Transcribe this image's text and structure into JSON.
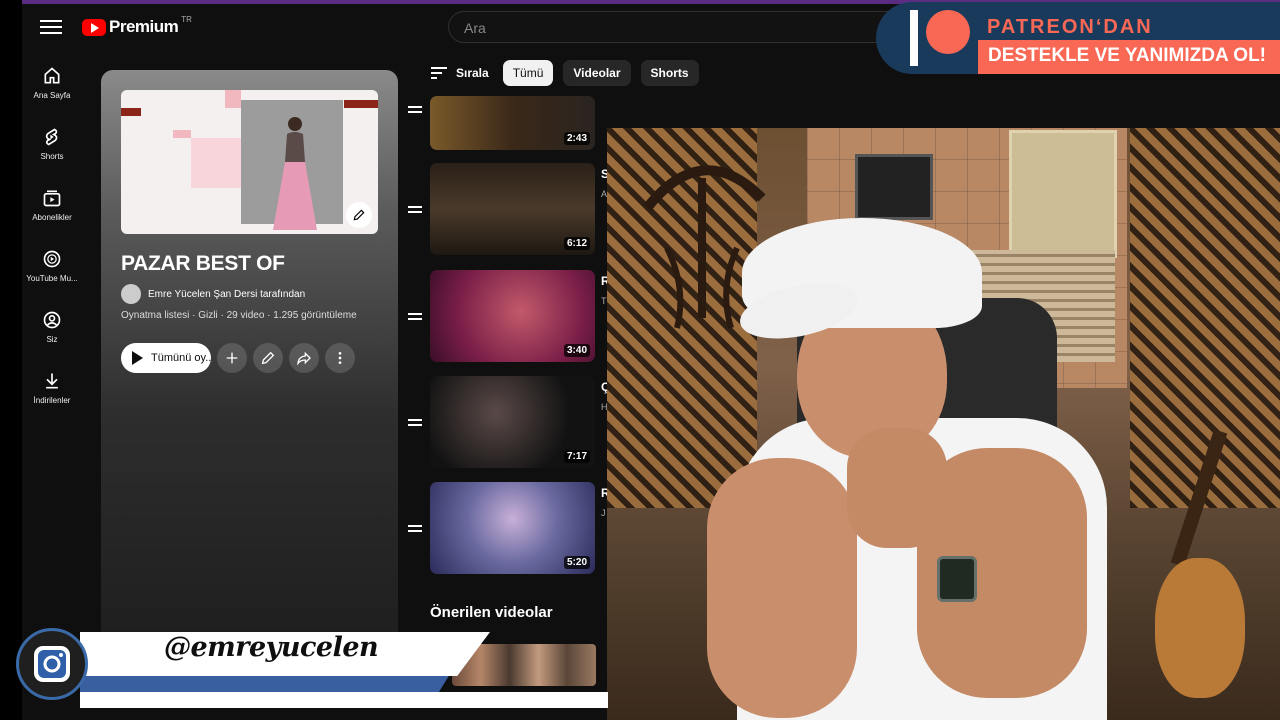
{
  "header": {
    "logo_text": "Premium",
    "logo_superscript": "TR",
    "search_placeholder": "Ara"
  },
  "sidebar": {
    "items": [
      {
        "label": "Ana Sayfa",
        "icon": "home-icon"
      },
      {
        "label": "Shorts",
        "icon": "shorts-icon"
      },
      {
        "label": "Abonelikler",
        "icon": "subscriptions-icon"
      },
      {
        "label": "YouTube Mu...",
        "icon": "youtube-music-icon"
      },
      {
        "label": "Siz",
        "icon": "user-icon"
      },
      {
        "label": "İndirilenler",
        "icon": "download-icon"
      }
    ]
  },
  "playlist": {
    "title": "PAZAR BEST OF",
    "owner": "Emre Yücelen Şan Dersi tarafından",
    "meta": "Oynatma listesi · Gizli · 29 video · 1.295 görüntüleme",
    "play_all_label": "Tümünü oy..."
  },
  "filters": {
    "sort_label": "Sırala",
    "chips": [
      "Tümü",
      "Videolar",
      "Shorts"
    ],
    "active": "Tümü"
  },
  "videos": [
    {
      "duration": "2:43",
      "title_cut": "",
      "sub_cut": ""
    },
    {
      "duration": "6:12",
      "title_cut": "S",
      "sub_cut": "A"
    },
    {
      "duration": "3:40",
      "title_cut": "R",
      "sub_cut": "T"
    },
    {
      "duration": "7:17",
      "title_cut": "Ç",
      "sub_cut": "H"
    },
    {
      "duration": "5:20",
      "title_cut": "R",
      "sub_cut": "J"
    }
  ],
  "suggested": {
    "heading": "Önerilen videolar"
  },
  "overlays": {
    "patreon_line1": "PATREON‘DAN",
    "patreon_line2": "DESTEKLE VE YANIMIZDA OL!",
    "instagram_handle": "@emreyucelen"
  },
  "colors": {
    "patreon_coral": "#f96854",
    "patreon_navy": "#1a3a5c",
    "youtube_red": "#ff0000"
  }
}
